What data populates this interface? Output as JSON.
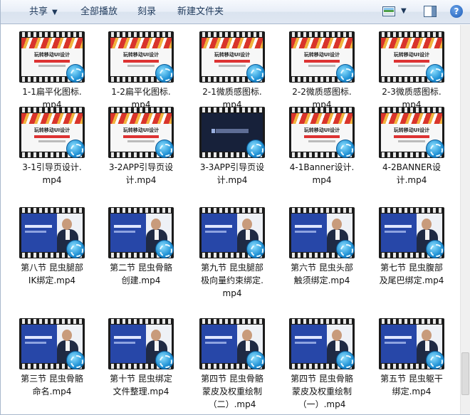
{
  "toolbar": {
    "share_label": "共享",
    "play_all_label": "全部播放",
    "burn_label": "刻录",
    "new_folder_label": "新建文件夹",
    "help_label": "?"
  },
  "files": [
    {
      "line1": "1-1扁平化图标.",
      "line2": "mp4",
      "line3": "",
      "thumb": "design",
      "thumb_title": "玩转移动UI设计"
    },
    {
      "line1": "1-2扁平化图标.",
      "line2": "mp4",
      "line3": "",
      "thumb": "design",
      "thumb_title": "玩转移动UI设计"
    },
    {
      "line1": "2-1微质感图标.",
      "line2": "mp4",
      "line3": "",
      "thumb": "design",
      "thumb_title": "玩转移动UI设计"
    },
    {
      "line1": "2-2微质感图标.",
      "line2": "mp4",
      "line3": "",
      "thumb": "design",
      "thumb_title": "玩转移动UI设计"
    },
    {
      "line1": "2-3微质感图标.",
      "line2": "mp4",
      "line3": "",
      "thumb": "design",
      "thumb_title": "玩转移动UI设计"
    },
    {
      "line1": "3-1引导页设计.",
      "line2": "mp4",
      "line3": "",
      "thumb": "design",
      "thumb_title": "玩转移动UI设计"
    },
    {
      "line1": "3-2APP引导页设",
      "line2": "计.mp4",
      "line3": "",
      "thumb": "design",
      "thumb_title": "玩转移动UI设计"
    },
    {
      "line1": "3-3APP引导页设",
      "line2": "计.mp4",
      "line3": "",
      "thumb": "dark",
      "thumb_title": ""
    },
    {
      "line1": "4-1Banner设计.",
      "line2": "mp4",
      "line3": "",
      "thumb": "design",
      "thumb_title": "玩转移动UI设计"
    },
    {
      "line1": "4-2BANNER设",
      "line2": "计.mp4",
      "line3": "",
      "thumb": "design",
      "thumb_title": "玩转移动UI设计"
    },
    {
      "line1": "第八节 昆虫腿部",
      "line2": "IK绑定.mp4",
      "line3": "",
      "thumb": "blue",
      "thumb_title": ""
    },
    {
      "line1": "第二节 昆虫骨骼",
      "line2": "创建.mp4",
      "line3": "",
      "thumb": "blue",
      "thumb_title": ""
    },
    {
      "line1": "第九节 昆虫腿部",
      "line2": "极向量约束绑定.",
      "line3": "mp4",
      "thumb": "blue",
      "thumb_title": ""
    },
    {
      "line1": "第六节 昆虫头部",
      "line2": "触须绑定.mp4",
      "line3": "",
      "thumb": "blue",
      "thumb_title": ""
    },
    {
      "line1": "第七节 昆虫腹部",
      "line2": "及尾巴绑定.mp4",
      "line3": "",
      "thumb": "blue",
      "thumb_title": ""
    },
    {
      "line1": "第三节 昆虫骨骼",
      "line2": "命名.mp4",
      "line3": "",
      "thumb": "blue",
      "thumb_title": ""
    },
    {
      "line1": "第十节 昆虫绑定",
      "line2": "文件整理.mp4",
      "line3": "",
      "thumb": "blue",
      "thumb_title": ""
    },
    {
      "line1": "第四节 昆虫骨骼",
      "line2": "蒙皮及权重绘制",
      "line3": "（二）.mp4",
      "thumb": "blue",
      "thumb_title": ""
    },
    {
      "line1": "第四节 昆虫骨骼",
      "line2": "蒙皮及权重绘制",
      "line3": "（一）.mp4",
      "thumb": "blue",
      "thumb_title": ""
    },
    {
      "line1": "第五节 昆虫躯干",
      "line2": "绑定.mp4",
      "line3": "",
      "thumb": "blue",
      "thumb_title": ""
    }
  ]
}
